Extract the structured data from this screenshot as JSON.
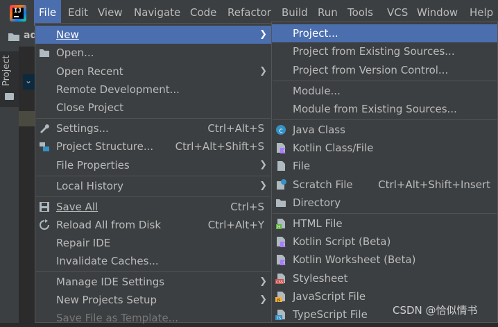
{
  "menubar": {
    "items": [
      "File",
      "Edit",
      "View",
      "Navigate",
      "Code",
      "Refactor",
      "Build",
      "Run",
      "Tools",
      "VCS",
      "Window",
      "Help"
    ]
  },
  "toolbar": {
    "project_name": "ad"
  },
  "sidebar": {
    "project_tab": "Project"
  },
  "file_menu": {
    "new": "New",
    "open": "Open...",
    "open_recent": "Open Recent",
    "remote_development": "Remote Development...",
    "close_project": "Close Project",
    "settings": "Settings...",
    "settings_shortcut": "Ctrl+Alt+S",
    "project_structure": "Project Structure...",
    "project_structure_shortcut": "Ctrl+Alt+Shift+S",
    "file_properties": "File Properties",
    "local_history": "Local History",
    "save_all": "Save All",
    "save_all_shortcut": "Ctrl+S",
    "reload_all": "Reload All from Disk",
    "reload_all_shortcut": "Ctrl+Alt+Y",
    "repair_ide": "Repair IDE",
    "invalidate_caches": "Invalidate Caches...",
    "manage_ide_settings": "Manage IDE Settings",
    "new_projects_setup": "New Projects Setup",
    "save_file_as_template": "Save File as Template..."
  },
  "new_menu": {
    "project": "Project...",
    "project_existing": "Project from Existing Sources...",
    "project_vcs": "Project from Version Control...",
    "module": "Module...",
    "module_existing": "Module from Existing Sources...",
    "java_class": "Java Class",
    "kotlin_class": "Kotlin Class/File",
    "file": "File",
    "scratch_file": "Scratch File",
    "scratch_file_shortcut": "Ctrl+Alt+Shift+Insert",
    "directory": "Directory",
    "html_file": "HTML File",
    "kotlin_script": "Kotlin Script (Beta)",
    "kotlin_worksheet": "Kotlin Worksheet (Beta)",
    "stylesheet": "Stylesheet",
    "javascript_file": "JavaScript File",
    "typescript_file": "TypeScript File"
  },
  "watermark": "CSDN @恰似情书",
  "colors": {
    "highlight": "#4b6eaf",
    "menu_bg": "#3c3f41",
    "text": "#bbbbbb"
  }
}
